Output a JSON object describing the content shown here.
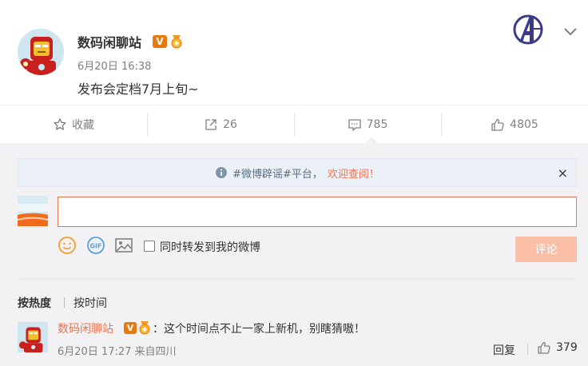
{
  "post": {
    "author": "数码闲聊站",
    "verified_badge": "V",
    "time": "6月20日 16:38",
    "text": "发布会定档7月上旬~",
    "avengers_logo_letter": "A"
  },
  "actions": {
    "favorite_label": "收藏",
    "repost_count": "26",
    "comment_count": "785",
    "like_count": "4805"
  },
  "notice": {
    "hint": "#微博辟谣#平台，",
    "link": "欢迎查阅！",
    "close": "×"
  },
  "composer": {
    "input_value": "",
    "input_placeholder": "",
    "repost_checkbox_label": "同时转发到我的微博",
    "submit_label": "评论",
    "gif_label": "GIF"
  },
  "sort": {
    "by_hot": "按热度",
    "by_time": "按时间"
  },
  "comment": {
    "author": "数码闲聊站",
    "verified_badge": "V",
    "text": "：这个时间点不止一家上新机，别瞎猜嗷！",
    "time": "6月20日 17:27 来自四川",
    "reply_label": "回复",
    "like_count": "379"
  },
  "colors": {
    "accent": "#eb7350",
    "badge_orange": "#e8790d",
    "submit_disabled": "#fbbfa7",
    "comment_bg": "#f2f2f5",
    "notice_bg": "#ebf1f6"
  },
  "icons": [
    "star-icon",
    "repost-icon",
    "comment-icon",
    "thumbs-up-icon",
    "chevron-down-icon",
    "info-icon",
    "close-icon",
    "smiley-icon",
    "gif-icon",
    "image-icon",
    "avengers-logo-icon",
    "medal-icon"
  ]
}
